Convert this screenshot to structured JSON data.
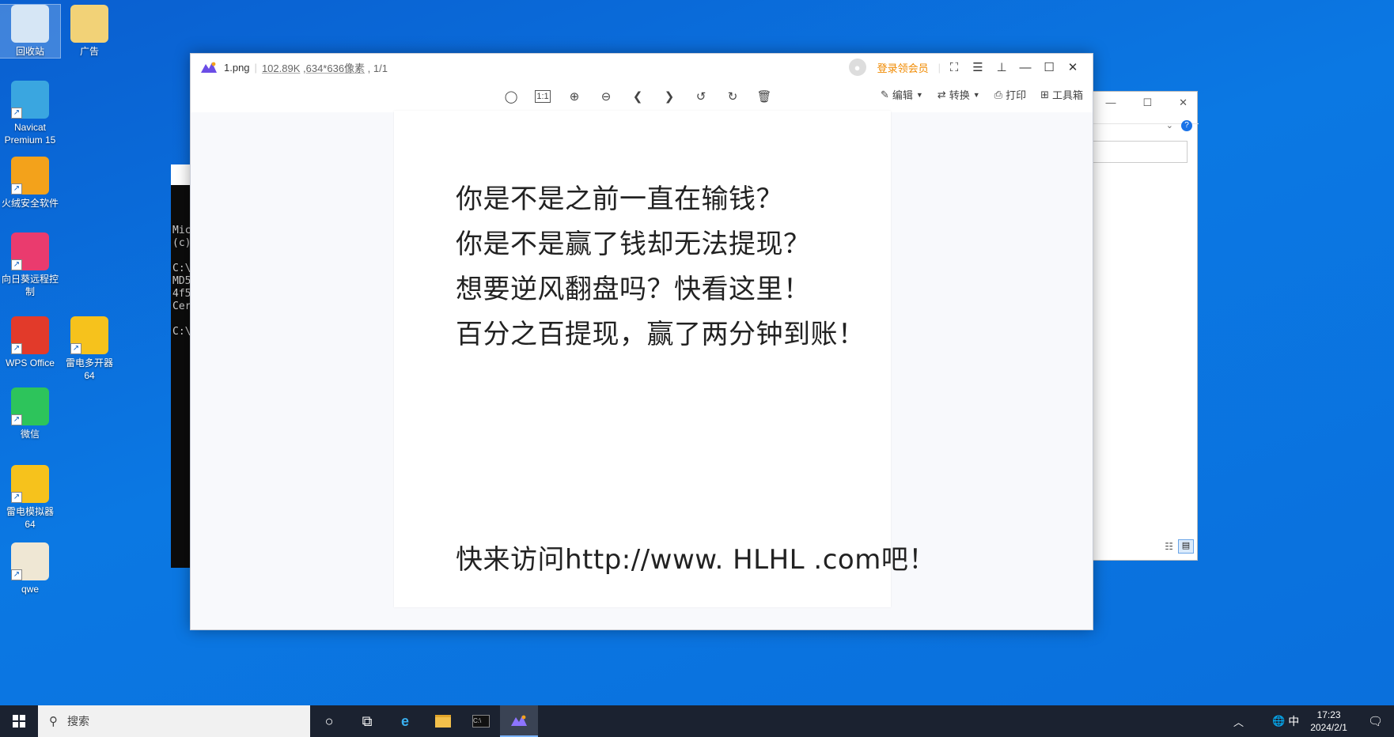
{
  "desktop": {
    "icons": [
      {
        "label": "回收站",
        "icon": "recycle-bin-icon",
        "color": "#d6e6f5"
      },
      {
        "label": "广告",
        "icon": "document-folder-icon",
        "color": "#f2d277"
      },
      {
        "label": "Navicat Premium 15",
        "icon": "navicat-icon",
        "color": "#3aa6e0"
      },
      {
        "label": "火绒安全软件",
        "icon": "huorong-shield-icon",
        "color": "#f3a21b"
      },
      {
        "label": "向日葵远程控制",
        "icon": "sunflower-remote-icon",
        "color": "#ea3b6e"
      },
      {
        "label": "WPS Office",
        "icon": "wps-icon",
        "color": "#e23a2a"
      },
      {
        "label": "雷电多开器64",
        "icon": "ldplayer-multi-icon",
        "color": "#f6c21c"
      },
      {
        "label": "微信",
        "icon": "wechat-icon",
        "color": "#2dc45b"
      },
      {
        "label": "雷电模拟器64",
        "icon": "ldplayer-icon",
        "color": "#f6c21c"
      },
      {
        "label": "qwe",
        "icon": "certificate-icon",
        "color": "#efe7d4"
      }
    ]
  },
  "cmd": {
    "lines": [
      "Mic",
      "(c)",
      "",
      "C:\\",
      "MD5",
      "4f5",
      "Cer",
      "",
      "C:\\"
    ]
  },
  "viewer": {
    "filename": "1.png",
    "filesize": "102.89K",
    "dimensions": "634*636像素",
    "page": "1/1",
    "login": "登录领会员",
    "accent": "#f08a00",
    "actions": {
      "edit": "编辑",
      "convert": "转换",
      "print": "打印",
      "toolbox": "工具箱"
    },
    "image_lines": [
      "你是不是之前一直在输钱？",
      "你是不是赢了钱却无法提现？",
      "想要逆风翻盘吗？快看这里！",
      "百分之百提现，赢了两分钟到账！",
      "快来访问http://www. HLHL .com吧！"
    ]
  },
  "taskbar": {
    "search_placeholder": "搜索",
    "ime": "中",
    "time": "17:23",
    "date": "2024/2/1"
  }
}
